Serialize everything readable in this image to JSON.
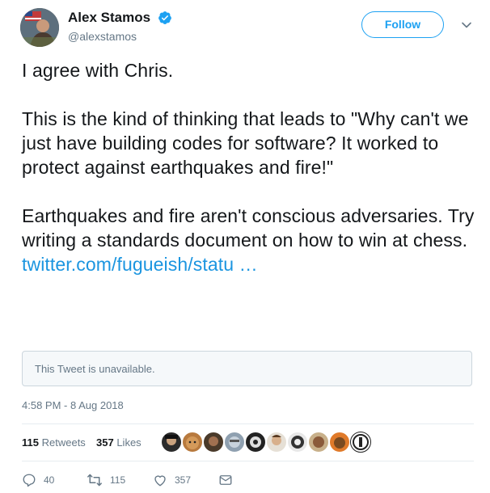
{
  "user": {
    "display_name": "Alex Stamos",
    "handle": "@alexstamos",
    "verified": true
  },
  "header": {
    "follow_label": "Follow"
  },
  "tweet": {
    "paragraphs": [
      "I agree with Chris.",
      "This is the kind of thinking that leads to \"Why can't we just have building codes for software? It worked to protect against earthquakes and fire!\"",
      "Earthquakes and fire aren't conscious adversaries. Try writing a standards document on how to win at chess."
    ],
    "link_text": "twitter.com/fugueish/statu …"
  },
  "quoted_card": {
    "text": "This Tweet is unavailable."
  },
  "timestamp": "4:58 PM - 8 Aug 2018",
  "stats": {
    "retweets_count": "115",
    "retweets_label": "Retweets",
    "likes_count": "357",
    "likes_label": "Likes"
  },
  "actions": {
    "reply_count": "40",
    "retweet_count": "115",
    "like_count": "357"
  },
  "colors": {
    "accent": "#1da1f2",
    "link": "#1b95e0",
    "muted": "#657786",
    "text": "#14171a"
  },
  "icons": [
    "verified-badge-icon",
    "chevron-down-icon",
    "reply-icon",
    "retweet-icon",
    "like-icon",
    "dm-icon"
  ]
}
